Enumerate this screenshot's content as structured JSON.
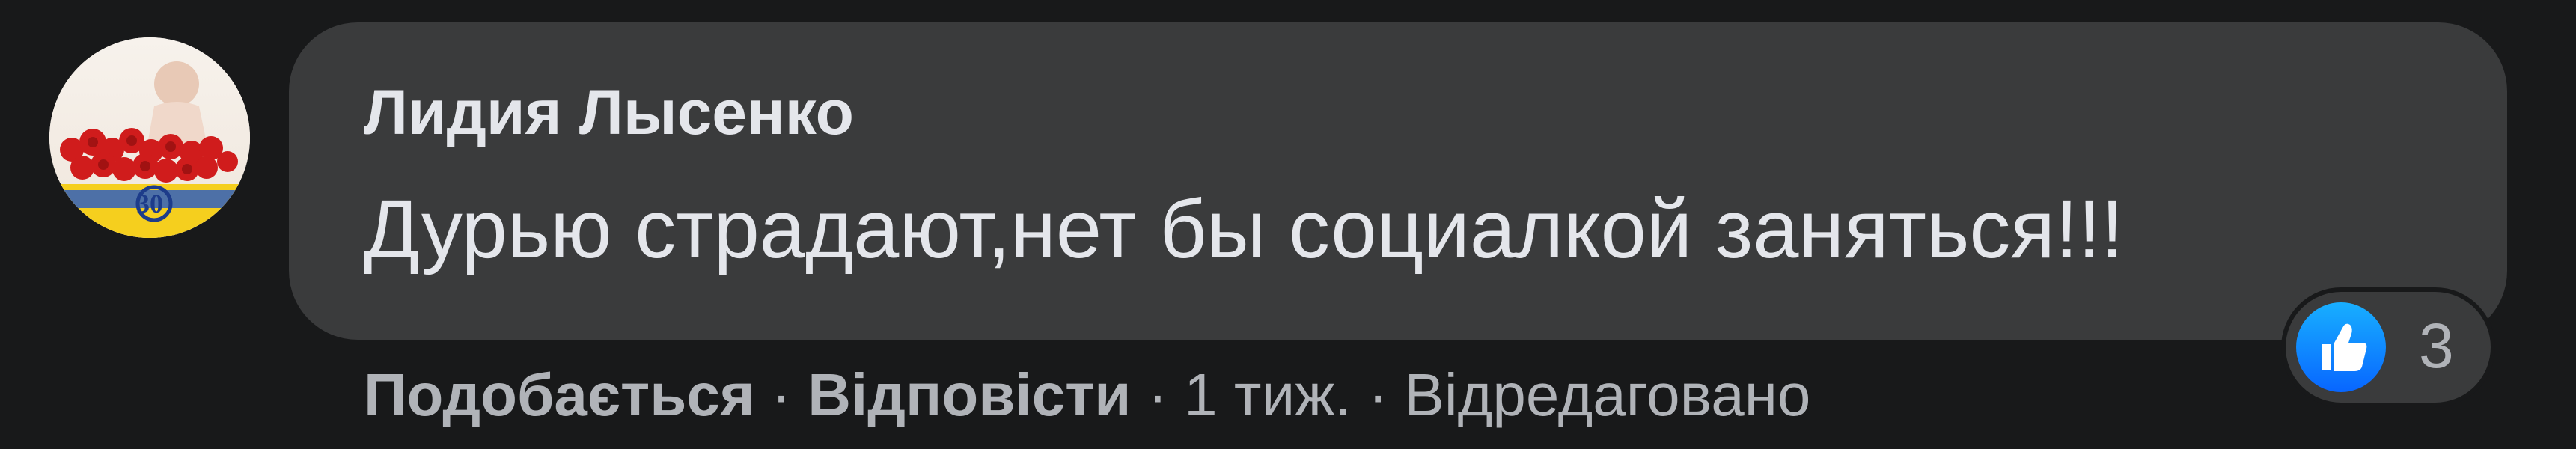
{
  "comment": {
    "author": "Лидия Лысенко",
    "text": "Дурью страдают,нет бы социалкой заняться!!!",
    "reactions": {
      "icon": "like-icon",
      "count": "3",
      "color": "#0866ff"
    },
    "actions": {
      "like_label": "Подобається",
      "reply_label": "Відповісти",
      "time": "1 тиж.",
      "edited_label": "Відредаговано",
      "separator": "·"
    },
    "avatar_badge_text": "30"
  },
  "theme": {
    "background": "#18191a",
    "bubble": "#3a3b3c",
    "primary_text": "#e4e6eb",
    "secondary_text": "#b0b3b8"
  }
}
